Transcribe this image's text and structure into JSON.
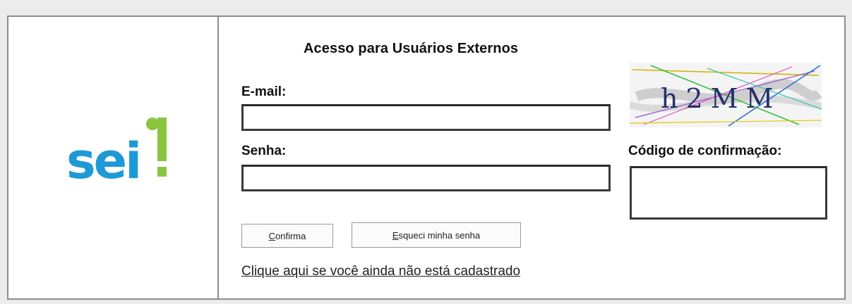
{
  "logo": {
    "text": "sei",
    "accent": "!",
    "colors": {
      "blue": "#1d9ad6",
      "green": "#8bc43f"
    }
  },
  "form": {
    "title": "Acesso para Usuários Externos",
    "email_label": "E-mail:",
    "email_value": "",
    "password_label": "Senha:",
    "password_value": "",
    "captcha_text": "h2MM",
    "captcha_label": "Código de confirmação:",
    "captcha_value": "",
    "confirm_button": {
      "accesskey": "C",
      "rest": "onfirma"
    },
    "forgot_button": {
      "accesskey": "E",
      "rest": "squeci minha senha"
    },
    "register_link": "Clique aqui se você ainda não está cadastrado"
  }
}
